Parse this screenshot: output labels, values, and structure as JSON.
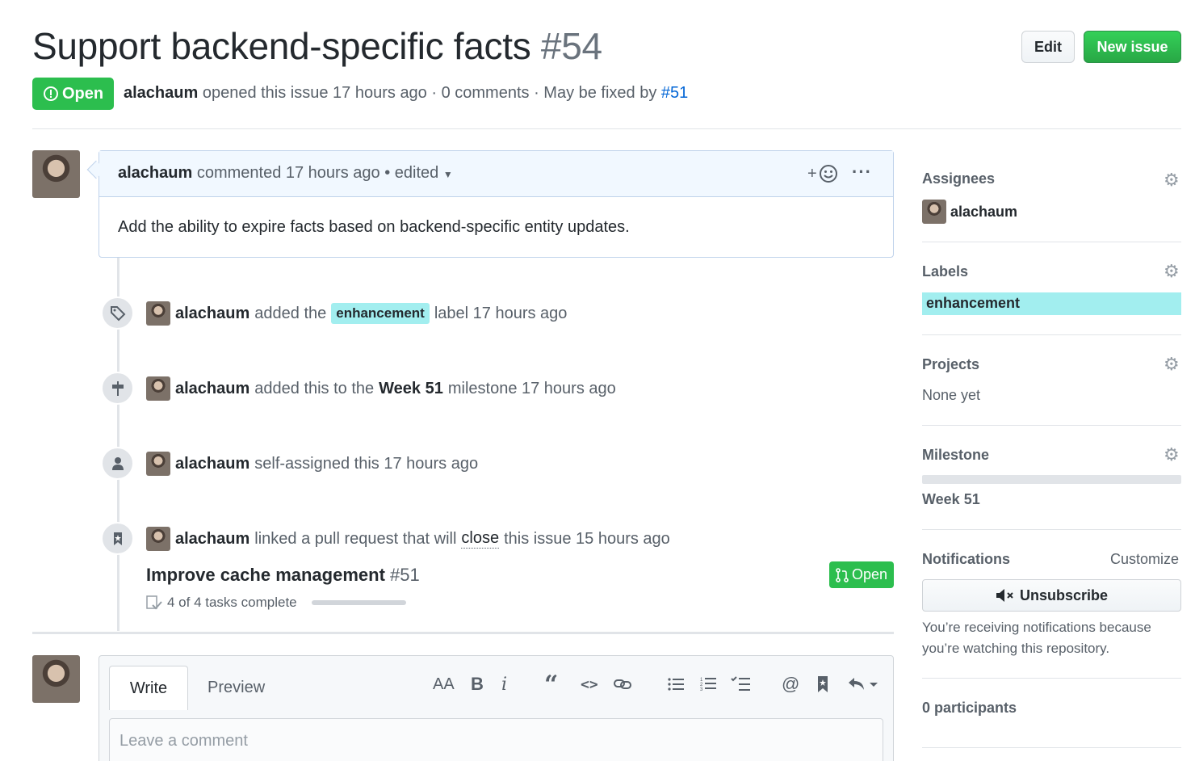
{
  "issue": {
    "title": "Support backend-specific facts",
    "number": "#54",
    "state": "Open",
    "author": "alachaum",
    "meta_text": "opened this issue 17 hours ago · 0 comments · May be fixed by",
    "fix_link": "#51"
  },
  "header_buttons": {
    "edit": "Edit",
    "new_issue": "New issue"
  },
  "comment": {
    "author": "alachaum",
    "meta": "commented 17 hours ago • edited",
    "body": "Add the ability to expire facts based on backend-specific entity updates."
  },
  "timeline": {
    "label_event": {
      "user": "alachaum",
      "pre": "added the",
      "label": "enhancement",
      "post": "label 17 hours ago"
    },
    "milestone_event": {
      "user": "alachaum",
      "pre": "added this to the",
      "milestone": "Week 51",
      "post": "milestone 17 hours ago"
    },
    "assign_event": {
      "user": "alachaum",
      "text": "self-assigned this 17 hours ago"
    },
    "link_event": {
      "user": "alachaum",
      "pre": "linked a pull request that will",
      "close_word": "close",
      "post": "this issue 15 hours ago"
    },
    "pr": {
      "title": "Improve cache management",
      "number": "#51",
      "state": "Open",
      "tasks": "4 of 4 tasks complete"
    }
  },
  "new_comment": {
    "tab_write": "Write",
    "tab_preview": "Preview",
    "placeholder": "Leave a comment",
    "toolbar": [
      "heading-icon",
      "bold-icon",
      "italic-icon",
      "quote-icon",
      "code-icon",
      "link-icon",
      "bullet-list-icon",
      "numbered-list-icon",
      "task-list-icon",
      "mention-icon",
      "bookmark-icon",
      "reply-icon"
    ]
  },
  "sidebar": {
    "assignees": {
      "heading": "Assignees",
      "user": "alachaum"
    },
    "labels": {
      "heading": "Labels",
      "label": "enhancement",
      "color": "#a2eeef"
    },
    "projects": {
      "heading": "Projects",
      "value": "None yet"
    },
    "milestone": {
      "heading": "Milestone",
      "value": "Week 51"
    },
    "notifications": {
      "heading": "Notifications",
      "customize": "Customize",
      "button": "Unsubscribe",
      "note": "You’re receiving notifications because you’re watching this repository."
    },
    "participants": "0 participants"
  },
  "colors": {
    "open_green": "#2cbe4e",
    "link_blue": "#0366d6",
    "label_cyan": "#a2eeef"
  }
}
